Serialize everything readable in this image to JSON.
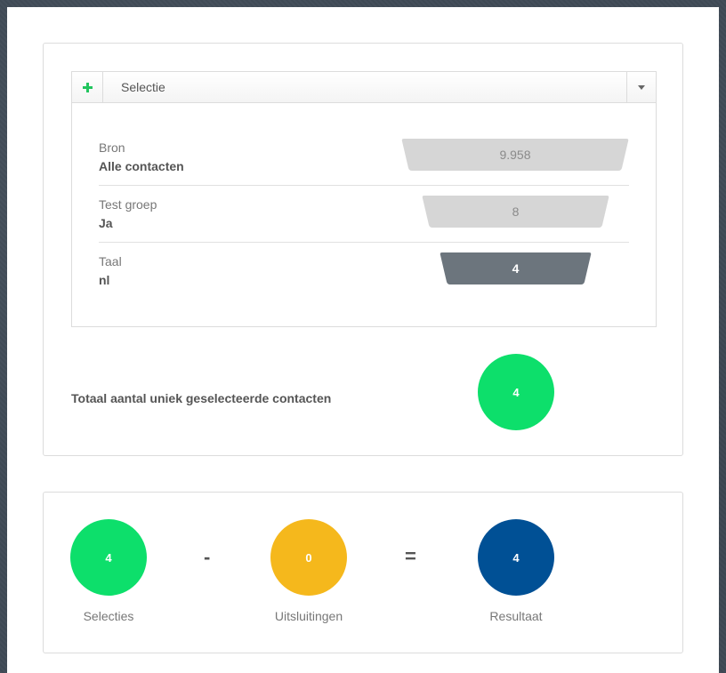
{
  "selection": {
    "title": "Selectie",
    "add_icon": "plus-icon",
    "toggle_icon": "caret-down-icon",
    "rows": [
      {
        "label": "Bron",
        "value": "Alle contacten",
        "count": "9.958",
        "style": "light"
      },
      {
        "label": "Test groep",
        "value": "Ja",
        "count": "8",
        "style": "light"
      },
      {
        "label": "Taal",
        "value": "nl",
        "count": "4",
        "style": "dark"
      }
    ],
    "total_label": "Totaal aantal uniek geselecteerde contacten",
    "total_count": "4"
  },
  "result": {
    "selecties": {
      "count": "4",
      "label": "Selecties"
    },
    "minus": "-",
    "uitsluitingen": {
      "count": "0",
      "label": "Uitsluitingen"
    },
    "equals": "=",
    "resultaat": {
      "count": "4",
      "label": "Resultaat"
    }
  },
  "colors": {
    "green": "#0ddf6b",
    "yellow": "#f5b81c",
    "blue": "#005095",
    "funnel_light": "#d6d6d6",
    "funnel_dark": "#6c757d"
  }
}
